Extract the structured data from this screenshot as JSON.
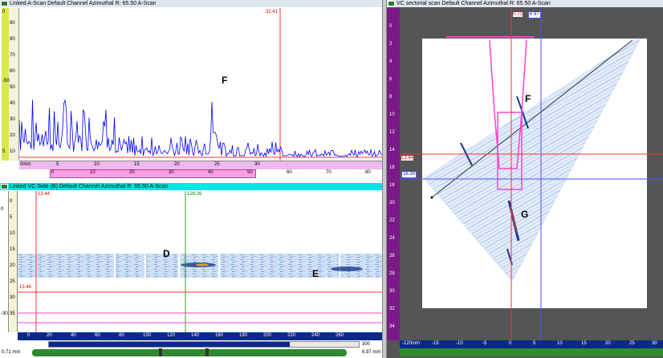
{
  "ascan": {
    "title": "Linked A-Scan Default Channel Azimuthal   R: 65.50 A-Scan",
    "cursor_label": "32.41",
    "y_ticks": [
      "90",
      "80",
      "70",
      "60",
      "50",
      "40",
      "30",
      "20",
      "10",
      "0"
    ],
    "y_labels": [
      "0",
      "-50",
      "5"
    ],
    "x_unit": "0mm",
    "x_ticks": [
      "5",
      "10",
      "15",
      "20",
      "25",
      "30"
    ],
    "bottom_ticks": [
      "0",
      "10",
      "20",
      "30",
      "40",
      "50",
      "60",
      "70",
      "80"
    ],
    "peak_label": "F",
    "line_color": "#0000ff"
  },
  "bscan": {
    "title": "Linked VC-Side (B) Default Channel Azimuthal   R: 65.50 A-Scan",
    "cursor_left": "13.44",
    "cursor_right": "129.26",
    "hline_label": "13.44",
    "y_ticks": [
      "0",
      "5",
      "10",
      "15",
      "20",
      "25",
      "30",
      "35"
    ],
    "y_labels": [
      "0",
      "-30"
    ],
    "x_ticks": [
      "0",
      "20",
      "40",
      "60",
      "80",
      "100",
      "120",
      "140",
      "160",
      "180",
      "200",
      "220",
      "240",
      "260"
    ],
    "scroll_max": "300",
    "range_left": "0.71 mm",
    "range_right": "6.97 mm",
    "labels": [
      "D",
      "E"
    ]
  },
  "sector": {
    "title": "VC sectorial scan Default Channel Azimuthal   R: 65.50 A-Scan",
    "top_red": "0.71",
    "top_blue": "6.97",
    "left_red": "13.44",
    "left_blue": "16.39",
    "y_ticks": [
      "0",
      "2",
      "4",
      "6",
      "8",
      "10",
      "12",
      "14",
      "16",
      "18",
      "20",
      "22",
      "24",
      "26",
      "28",
      "30",
      "32",
      "34"
    ],
    "x_ticks": [
      "-120mm",
      "-15",
      "-10",
      "-5",
      "0",
      "5",
      "10",
      "15",
      "20",
      "25",
      "30"
    ],
    "labels": [
      "F",
      "G"
    ]
  },
  "colors": {
    "accent_purple": "#7a1a86",
    "ruler_green": "#2e8b2e",
    "pink_bar": "#ff40d0",
    "cyan_bar": "#00e5e5",
    "cursor_red": "#ff3030",
    "cursor_blue": "#5050ff"
  }
}
